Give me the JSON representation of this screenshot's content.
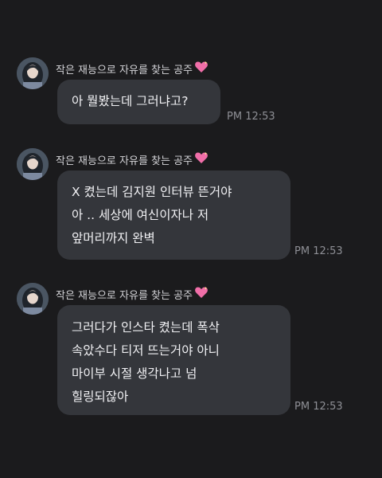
{
  "messages": [
    {
      "sender": "작은 재능으로 자유를 찾는 공주",
      "lines": [
        "아 뭘봤는데 그러냐고?"
      ],
      "time": "PM 12:53"
    },
    {
      "sender": "작은 재능으로 자유를 찾는 공주",
      "lines": [
        "X 켰는데 김지원 인터뷰 뜬거야",
        "아 .. 세상에 여신이자나 저",
        "앞머리까지 완벽"
      ],
      "time": "PM 12:53"
    },
    {
      "sender": "작은 재능으로 자유를 찾는 공주",
      "lines": [
        "그러다가 인스타 켰는데 폭삭",
        "속았수다 티저 뜨는거야 아니",
        "마이부 시절 생각나고 넘",
        "힐링되잖아"
      ],
      "time": "PM 12:53"
    }
  ],
  "icons": {
    "avatar": "profile-photo",
    "heart": "sparkling-heart-emoji"
  },
  "colors": {
    "background": "#1b1b1d",
    "bubble": "#34363b",
    "heart": "#f06ea8"
  }
}
